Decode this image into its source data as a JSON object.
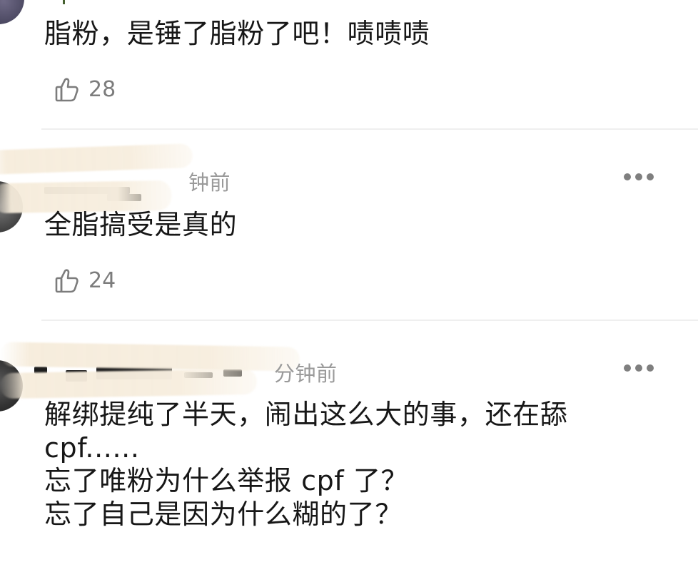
{
  "comments": [
    {
      "text": "脂粉，是锤了脂粉了吧！啧啧啧",
      "likes": "28"
    },
    {
      "time": "钟前",
      "text": "全脂搞受是真的",
      "likes": "24"
    },
    {
      "time": "分钟前",
      "text": "解绑提纯了半天，闹出这么大的事，还在舔\ncpf......\n忘了唯粉为什么举报 cpf 了？\n忘了自己是因为什么糊的了？"
    }
  ],
  "icons": {
    "like": "thumbs-up-icon",
    "more": "more-options-icon"
  },
  "colors": {
    "text": "#171717",
    "meta": "#9a9a9a",
    "icon": "#7c7c7c",
    "divider": "#efefef"
  }
}
